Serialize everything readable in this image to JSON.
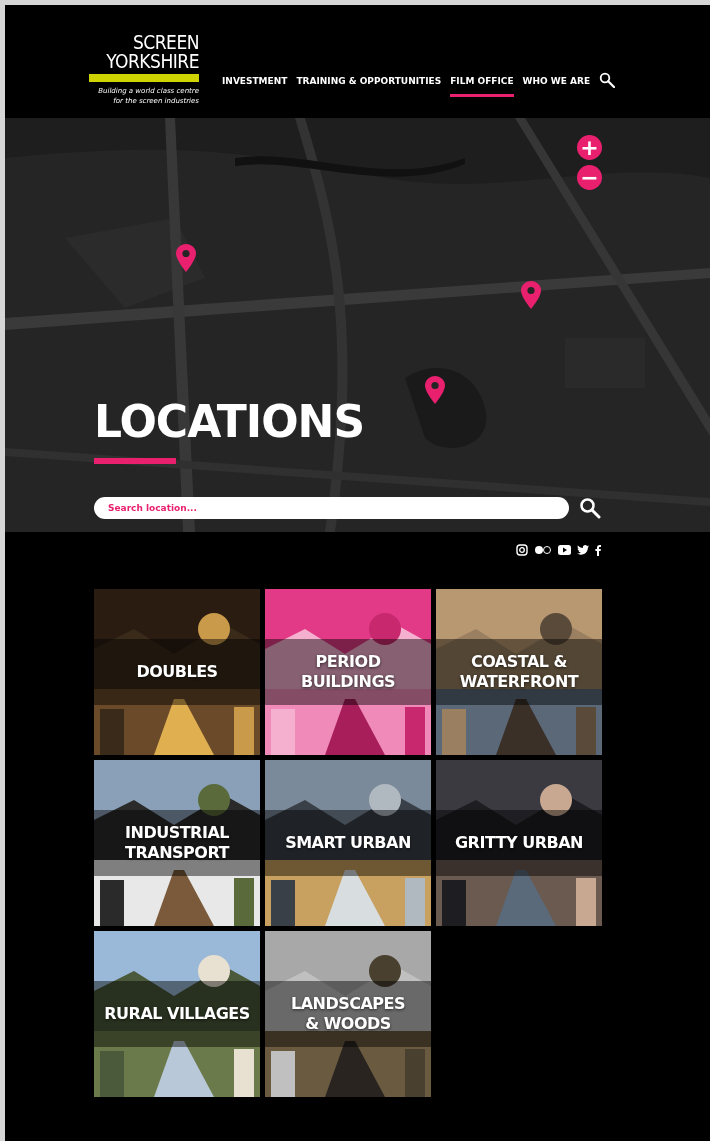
{
  "header": {
    "logo": {
      "line1": "SCREEN",
      "line2": "YORKSHIRE",
      "tagline": "Building a world class centre\nfor the screen industries"
    },
    "nav": [
      {
        "label": "INVESTMENT",
        "selected": false
      },
      {
        "label": "TRAINING & OPPORTUNITIES",
        "selected": false
      },
      {
        "label": "FILM OFFICE",
        "selected": true
      },
      {
        "label": "WHO WE ARE",
        "selected": false
      }
    ]
  },
  "map": {
    "zoom_in": "+",
    "zoom_out": "−",
    "heading": "LOCATIONS",
    "search": {
      "placeholder": "Search location..."
    }
  },
  "tiles": [
    {
      "label": "DOUBLES",
      "kind": "picture"
    },
    {
      "label": "PERIOD\nBUILDINGS",
      "kind": "picture"
    },
    {
      "label": "COASTAL &\nWATERFRONT",
      "kind": "picture"
    },
    {
      "label": "INDUSTRIAL\nTRANSPORT",
      "kind": "picture"
    },
    {
      "label": "SMART URBAN",
      "kind": "picture"
    },
    {
      "label": "GRITTY URBAN",
      "kind": "picture"
    },
    {
      "label": "RURAL VILLAGES",
      "kind": "picture"
    },
    {
      "label": "LANDSCAPES\n& WOODS",
      "kind": "picture"
    }
  ]
}
